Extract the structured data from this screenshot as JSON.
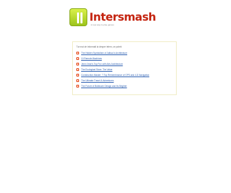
{
  "logo": {
    "title": "Intersmash",
    "tagline": "A new way to play games"
  },
  "panel": {
    "heading": "Tur mai de informatii la despre telem, ce poteti:",
    "links": [
      {
        "label": "The Hidden Symbolism of Jalisco's Architecture"
      },
      {
        "label": "10 Remote Machines"
      },
      {
        "label": "Jenni Jean's Top Fun with Arts Architecture"
      },
      {
        "label": "The Ecological Store: The Value"
      },
      {
        "label": "Construction Master: 7 Top Remembrance of GPS and 4-D Navigation"
      },
      {
        "label": "The Ultimate Travel & Adventures"
      },
      {
        "label": "The Future of Bulldozer Design and Its Brighter"
      }
    ]
  }
}
